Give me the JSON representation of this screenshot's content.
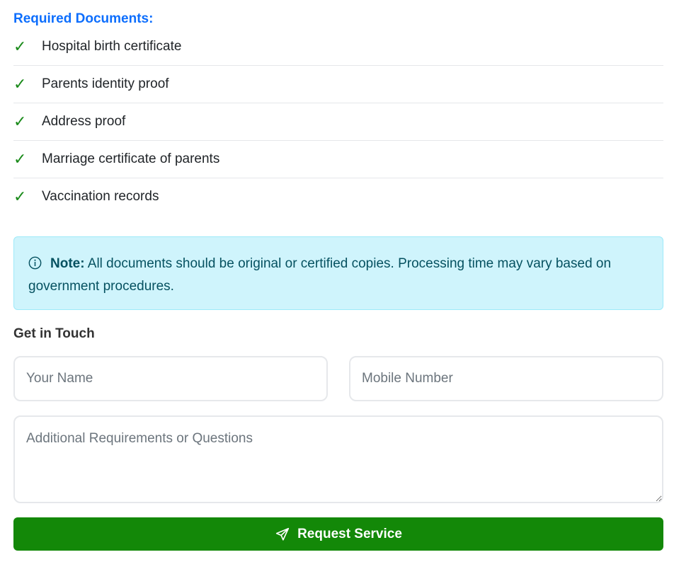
{
  "documents": {
    "heading": "Required Documents:",
    "check_mark": "✓",
    "items": [
      {
        "label": "Hospital birth certificate"
      },
      {
        "label": "Parents identity proof"
      },
      {
        "label": "Address proof"
      },
      {
        "label": "Marriage certificate of parents"
      },
      {
        "label": "Vaccination records"
      }
    ]
  },
  "note": {
    "icon": "info-circle-icon",
    "label": "Note:",
    "text": " All documents should be original or certified copies. Processing time may vary based on government procedures."
  },
  "contact": {
    "heading": "Get in Touch",
    "name_placeholder": "Your Name",
    "mobile_placeholder": "Mobile Number",
    "message_placeholder": "Additional Requirements or Questions",
    "submit_label": "Request Service",
    "submit_icon": "send-icon"
  },
  "colors": {
    "heading_blue": "#0d6efd",
    "check_green": "#198a19",
    "note_bg": "#cff4fc",
    "note_text": "#055160",
    "button_green": "#138808"
  }
}
